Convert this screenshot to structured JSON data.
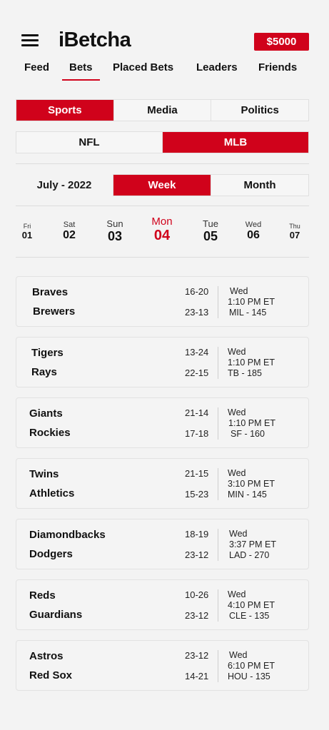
{
  "header": {
    "logo": "iBetcha",
    "balance": "$5000"
  },
  "nav": [
    "Feed",
    "Bets",
    "Placed Bets",
    "Leaders",
    "Friends"
  ],
  "categories": [
    "Sports",
    "Media",
    "Politics"
  ],
  "leagues": [
    "NFL",
    "MLB"
  ],
  "period": {
    "label": "July - 2022",
    "tabs": [
      "Week",
      "Month"
    ]
  },
  "days": [
    {
      "name": "Fri",
      "num": "01"
    },
    {
      "name": "Sat",
      "num": "02"
    },
    {
      "name": "Sun",
      "num": "03"
    },
    {
      "name": "Mon",
      "num": "04"
    },
    {
      "name": "Tue",
      "num": "05"
    },
    {
      "name": "Wed",
      "num": "06"
    },
    {
      "name": "Thu",
      "num": "07"
    }
  ],
  "games": [
    {
      "away": "Braves",
      "home": "Brewers",
      "away_rec": "16-20",
      "home_rec": "23-13",
      "day": "Wed",
      "time": "1:10 PM ET",
      "line": "MIL - 145"
    },
    {
      "away": "Tigers",
      "home": "Rays",
      "away_rec": "13-24",
      "home_rec": "22-15",
      "day": "Wed",
      "time": "1:10 PM ET",
      "line": "TB - 185"
    },
    {
      "away": "Giants",
      "home": "Rockies",
      "away_rec": "21-14",
      "home_rec": "17-18",
      "day": "Wed",
      "time": "1:10 PM ET",
      "line": "SF - 160"
    },
    {
      "away": "Twins",
      "home": "Athletics",
      "away_rec": "21-15",
      "home_rec": "15-23",
      "day": "Wed",
      "time": "3:10 PM ET",
      "line": "MIN - 145"
    },
    {
      "away": "Diamondbacks",
      "home": "Dodgers",
      "away_rec": "18-19",
      "home_rec": "23-12",
      "day": "Wed",
      "time": "3:37 PM ET",
      "line": "LAD - 270"
    },
    {
      "away": "Reds",
      "home": "Guardians",
      "away_rec": "10-26",
      "home_rec": "23-12",
      "day": "Wed",
      "time": "4:10 PM ET",
      "line": "CLE - 135"
    },
    {
      "away": "Astros",
      "home": "Red Sox",
      "away_rec": "23-12",
      "home_rec": "14-21",
      "day": "Wed",
      "time": "6:10 PM ET",
      "line": "HOU - 135"
    }
  ]
}
